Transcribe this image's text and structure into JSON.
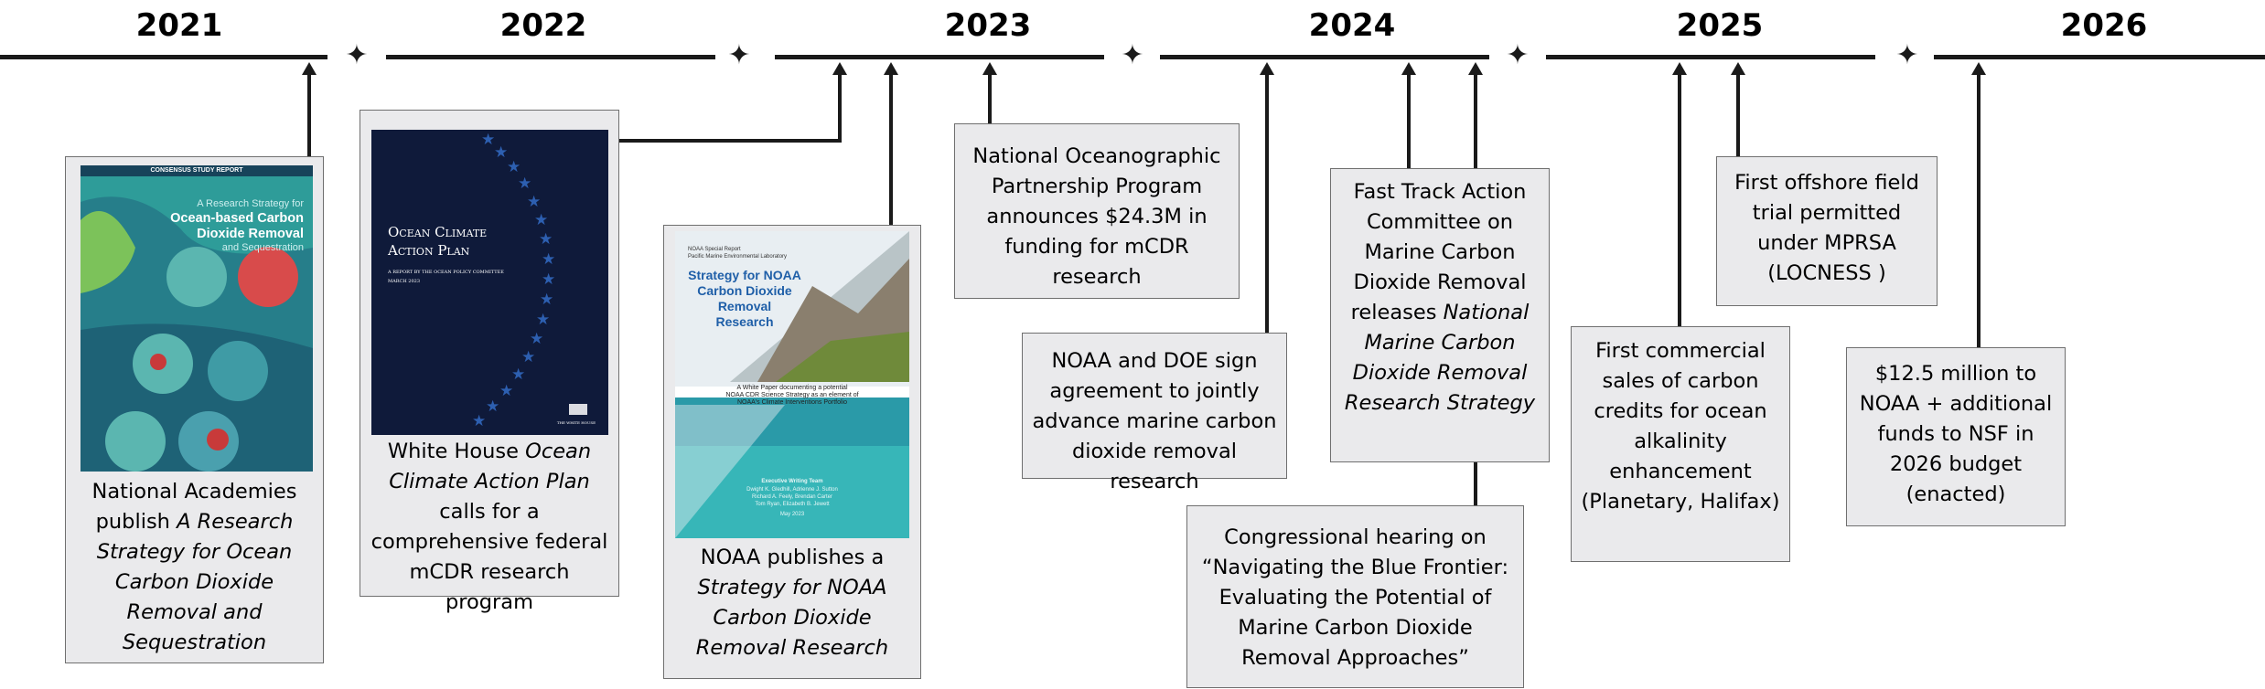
{
  "years": [
    "2021",
    "2022",
    "2023",
    "2024",
    "2025",
    "2026"
  ],
  "events": [
    {
      "id": "nas",
      "pre": "National Academies publish ",
      "italic": "A Research Strategy for Ocean Carbon Dioxide Removal and Sequestration",
      "post": ""
    },
    {
      "id": "whitehouse",
      "pre": "White House ",
      "italic": "Ocean Climate Action Plan",
      "post": " calls for a comprehensive federal mCDR research program"
    },
    {
      "id": "noaa_strategy",
      "pre": "NOAA publishes a ",
      "italic": "Strategy for NOAA Carbon Dioxide Removal Research",
      "post": ""
    },
    {
      "id": "nopp",
      "pre": "National Oceanographic Partnership Program announces $24.3M in funding for mCDR research",
      "italic": "",
      "post": ""
    },
    {
      "id": "noaa_doe",
      "pre": "NOAA and DOE sign agreement to jointly advance marine carbon dioxide removal research",
      "italic": "",
      "post": ""
    },
    {
      "id": "fasttrack",
      "pre": "Fast Track Action Committee on Marine Carbon Dioxide Removal releases ",
      "italic": "National Marine Carbon Dioxide Removal Research Strategy",
      "post": ""
    },
    {
      "id": "hearing",
      "pre": "Congressional hearing on “Navigating the Blue Frontier: Evaluating the Potential of Marine Carbon Dioxide Removal Approaches”",
      "italic": "",
      "post": ""
    },
    {
      "id": "commercial",
      "pre": "First commercial sales of carbon credits for ocean alkalinity enhancement (Planetary, Halifax)",
      "italic": "",
      "post": ""
    },
    {
      "id": "offshore",
      "pre": "First offshore field trial permitted under MPRSA (LOCNESS )",
      "italic": "",
      "post": ""
    },
    {
      "id": "budget",
      "pre": "$12.5 million to NOAA + additional funds to NSF in 2026 budget (enacted)",
      "italic": "",
      "post": ""
    }
  ],
  "covers": {
    "nas": {
      "banner": "CONSENSUS STUDY REPORT",
      "line1": "A Research Strategy for",
      "line2": "Ocean-based Carbon",
      "line3": "Dioxide Removal",
      "line4": "and Sequestration"
    },
    "whitehouse": {
      "title1": "Ocean Climate",
      "title2": "Action Plan",
      "sub": "A REPORT BY THE OCEAN POLICY COMMITTEE",
      "date": "MARCH 2023",
      "footer": "THE WHITE HOUSE"
    },
    "noaa": {
      "header1": "NOAA Special Report",
      "header2": "Pacific Marine Environmental Laboratory",
      "title1": "Strategy for NOAA",
      "title2": "Carbon Dioxide",
      "title3": "Removal",
      "title4": "Research",
      "band1": "A White Paper documenting a potential",
      "band2": "NOAA CDR Science Strategy as an element of",
      "band3": "NOAA's Climate Interventions Portfolio",
      "team": "Executive Writing Team",
      "authors1": "Dwight K. Gledhill, Adrienne J. Sutton",
      "authors2": "Richard A. Feely, Brendan Carter",
      "authors3": "Tom Ryan, Elizabeth B. Jewett",
      "date": "May 2023"
    }
  },
  "colors": {
    "line": "#1a1a1a",
    "box_fill": "#eaeaec",
    "box_border": "#6f6f6f",
    "navy": "#0f1a3a",
    "star_blue": "#2d5fb0",
    "teal": "#2e9c99"
  }
}
